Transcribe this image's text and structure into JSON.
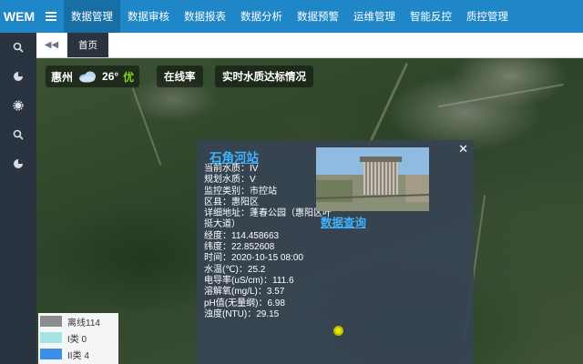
{
  "app": {
    "logo": "WEM"
  },
  "nav": {
    "items": [
      {
        "label": "数据管理",
        "active": true
      },
      {
        "label": "数据审核",
        "active": false
      },
      {
        "label": "数据报表",
        "active": false
      },
      {
        "label": "数据分析",
        "active": false
      },
      {
        "label": "数据预警",
        "active": false
      },
      {
        "label": "运维管理",
        "active": false
      },
      {
        "label": "智能反控",
        "active": false
      },
      {
        "label": "质控管理",
        "active": false
      }
    ]
  },
  "rail": {
    "icons": [
      "search-icon",
      "pie-chart-icon",
      "gear-icon",
      "search-icon",
      "pie-chart-icon"
    ]
  },
  "tabs": {
    "home": "首页"
  },
  "weather": {
    "city": "惠州",
    "temp": "26°",
    "air_quality": "优",
    "aq_color": "#7ed321"
  },
  "map_buttons": {
    "online_rate": "在线率",
    "realtime": "实时水质达标情况"
  },
  "popup": {
    "station_name": "石角河站",
    "query_link": "数据查询",
    "info": [
      "当前水质：IV",
      "规划水质：V",
      "监控类别：市控站",
      "区县：惠阳区",
      "详细地址：蓬春公园（惠阳区叶挺大道）",
      "经度：114.458663",
      "纬度：22.852608",
      "时间：2020-10-15 08:00",
      "水温(℃)：25.2",
      "电导率(uS/cm)：111.6",
      "溶解氧(mg/L)：3.57",
      "pH值(无量纲)：6.98",
      "浊度(NTU)：29.15"
    ]
  },
  "legend": [
    {
      "label": "离线114",
      "color": "#8c8c8c"
    },
    {
      "label": "I类 0",
      "color": "#a6e3e3"
    },
    {
      "label": "II类 4",
      "color": "#3c8fe6"
    }
  ],
  "colors": {
    "topbar": "#1f86c7",
    "rail": "#2a3440",
    "link": "#3fb3ff",
    "marker": "#e6e600"
  }
}
